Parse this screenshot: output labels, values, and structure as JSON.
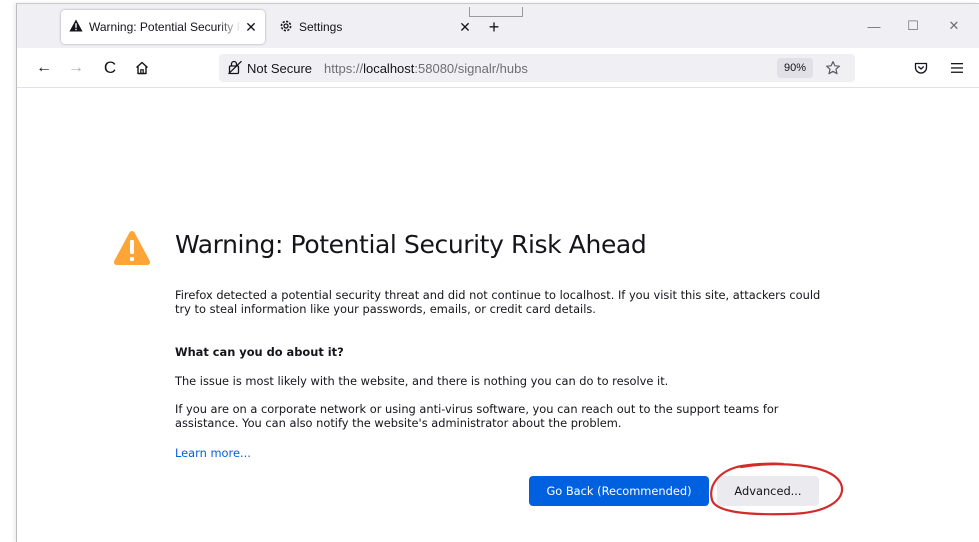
{
  "tabs": [
    {
      "label": "Warning: Potential Security Risk Ahead",
      "active": true
    },
    {
      "label": "Settings",
      "active": false
    }
  ],
  "tab_close_glyph": "✕",
  "new_tab_glyph": "+",
  "window": {
    "minimize": "—",
    "maximize": "☐",
    "close": "✕"
  },
  "nav": {
    "back": "←",
    "forward": "→",
    "reload": "C"
  },
  "urlbar": {
    "security_label": "Not Secure",
    "url_prefix": "https://",
    "url_host": "localhost",
    "url_rest": ":58080/signalr/hubs",
    "zoom": "90%"
  },
  "error_page": {
    "title": "Warning: Potential Security Risk Ahead",
    "intro": "Firefox detected a potential security threat and did not continue to localhost. If you visit this site, attackers could try to steal information like your passwords, emails, or credit card details.",
    "question": "What can you do about it?",
    "answer_1": "The issue is most likely with the website, and there is nothing you can do to resolve it.",
    "answer_2": "If you are on a corporate network or using anti-virus software, you can reach out to the support teams for assistance. You can also notify the website's administrator about the problem.",
    "learn_more": "Learn more...",
    "go_back_button": "Go Back (Recommended)",
    "advanced_button": "Advanced..."
  },
  "colors": {
    "warning_icon": "#ffa436",
    "primary_button": "#0061e0",
    "link": "#0061e0",
    "annotation_circle": "#d42a2a"
  },
  "icons": {
    "active_tab": "warning-triangle-icon",
    "settings_tab": "gear-icon",
    "home": "home-icon",
    "security": "insecure-lock-icon",
    "bookmark": "star-icon",
    "pocket": "pocket-icon",
    "menu": "hamburger-menu-icon"
  }
}
